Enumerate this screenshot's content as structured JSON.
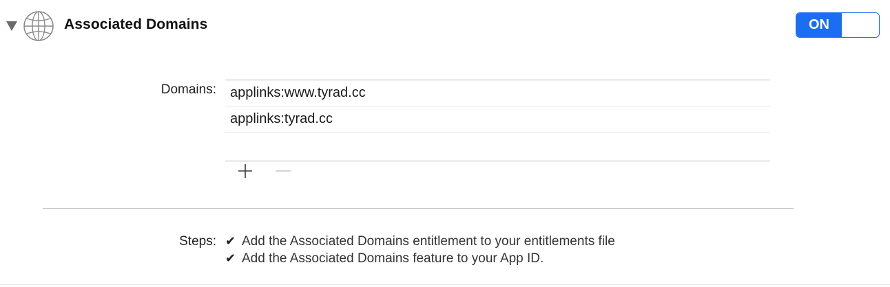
{
  "capability": {
    "title": "Associated Domains",
    "icon": "globe-icon",
    "toggle": {
      "state_label": "ON",
      "state": true,
      "accent_color": "#1a6ef3"
    }
  },
  "domains": {
    "label": "Domains:",
    "entries": [
      "applinks:www.tyrad.cc",
      "applinks:tyrad.cc"
    ],
    "add_icon": "plus-icon",
    "remove_icon": "minus-icon"
  },
  "steps": {
    "label": "Steps:",
    "items": [
      {
        "check": "✔",
        "text": "Add the Associated Domains entitlement to your entitlements file"
      },
      {
        "check": "✔",
        "text": "Add the Associated Domains feature to your App ID."
      }
    ]
  }
}
